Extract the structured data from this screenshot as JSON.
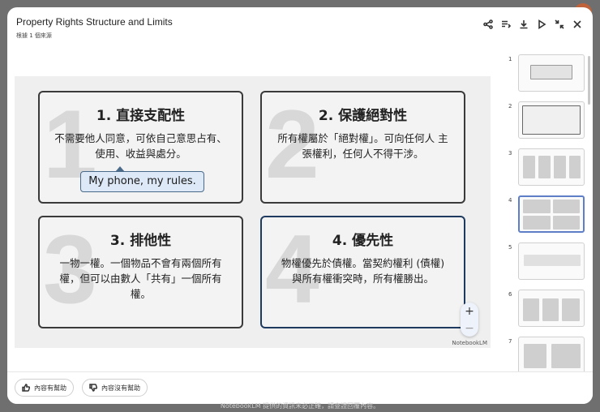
{
  "header": {
    "title": "Property Rights Structure and Limits",
    "subtitle": "根據 1 個來源"
  },
  "toolbar": {
    "icons": [
      "share-icon",
      "playlist-icon",
      "download-icon",
      "play-icon",
      "collapse-icon",
      "close-icon"
    ]
  },
  "slide": {
    "cards": [
      {
        "number": "1",
        "title": "1. 直接支配性",
        "body": "不需要他人同意，可依自己意思占有、使用、收益與處分。"
      },
      {
        "number": "2",
        "title": "2. 保護絕對性",
        "body": "所有權屬於「絕對權」。可向任何人 主張權利，任何人不得干涉。"
      },
      {
        "number": "3",
        "title": "3. 排他性",
        "body": "一物一權。一個物品不會有兩個所有權，但可以由數人「共有」一個所有權。"
      },
      {
        "number": "4",
        "title": "4. 優先性",
        "body": "物權優先於債權。當契約權利 (債權) 與所有權衝突時，所有權勝出。"
      }
    ],
    "bubble": "My phone, my rules.",
    "watermark": "NotebookLM"
  },
  "zoom": {
    "plus": "+",
    "minus": "−"
  },
  "thumbnails": {
    "numbers": [
      "1",
      "2",
      "3",
      "4",
      "5",
      "6",
      "7"
    ],
    "active": "4"
  },
  "feedback": {
    "helpful": "內容有幫助",
    "not_helpful": "內容沒有幫助"
  },
  "footer_note": "NotebookLM 提供的資訊未必正確，請查證回覆內容。",
  "colors": {
    "accent": "#5e7fc8",
    "card_border": "#3a3a3a",
    "card_highlight": "#1e3a5f",
    "bubble_fill": "#dde9f7"
  }
}
